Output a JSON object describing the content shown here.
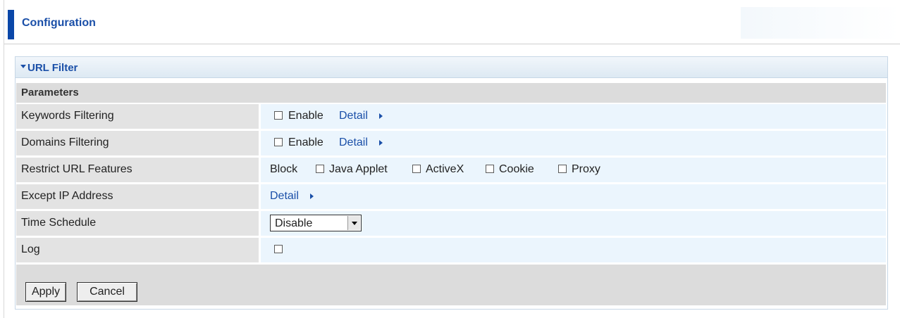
{
  "header": {
    "title": "Configuration"
  },
  "section": {
    "title": "URL Filter"
  },
  "parameters_label": "Parameters",
  "rows": {
    "keywords": {
      "label": "Keywords Filtering",
      "enable_label": "Enable",
      "detail_label": "Detail",
      "enabled": false
    },
    "domains": {
      "label": "Domains Filtering",
      "enable_label": "Enable",
      "detail_label": "Detail",
      "enabled": false
    },
    "restrict": {
      "label": "Restrict URL Features",
      "block_label": "Block",
      "options": [
        {
          "label": "Java Applet",
          "checked": false
        },
        {
          "label": "ActiveX",
          "checked": false
        },
        {
          "label": "Cookie",
          "checked": false
        },
        {
          "label": "Proxy",
          "checked": false
        }
      ]
    },
    "except_ip": {
      "label": "Except IP Address",
      "detail_label": "Detail"
    },
    "time_schedule": {
      "label": "Time Schedule",
      "selected": "Disable"
    },
    "log": {
      "label": "Log",
      "checked": false
    }
  },
  "buttons": {
    "apply": "Apply",
    "cancel": "Cancel"
  },
  "colors": {
    "accent": "#0a47a8",
    "link": "#1a4fa8",
    "row_value_bg": "#ebf5fd",
    "row_label_bg": "#e3e3e3"
  }
}
